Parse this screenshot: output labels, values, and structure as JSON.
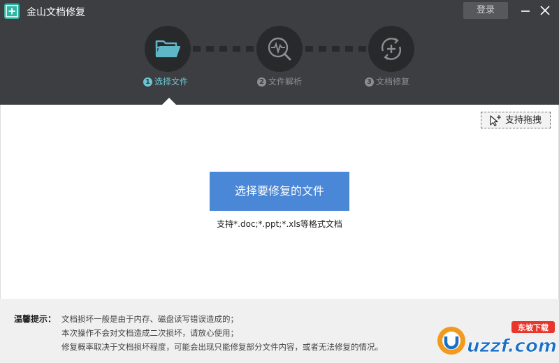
{
  "window": {
    "title": "金山文档修复",
    "login_label": "登录"
  },
  "steps": [
    {
      "number": "1",
      "label": "选择文件",
      "active": true
    },
    {
      "number": "2",
      "label": "文件解析",
      "active": false
    },
    {
      "number": "3",
      "label": "文档修复",
      "active": false
    }
  ],
  "main": {
    "drag_label": "支持拖拽",
    "select_button": "选择要修复的文件",
    "formats_hint": "支持*.doc;*.ppt;*.xls等格式文档"
  },
  "tips": {
    "label": "温馨提示：",
    "lines": [
      "文档损坏一般是由于内存、磁盘读写错误造成的；",
      "本次操作不会对文档造成二次损坏，请放心使用；",
      "修复概率取决于文档损坏程度，可能会出现只能修复部分文件内容，或者无法修复的情况。"
    ]
  },
  "watermark": {
    "brand": "uzzf.com",
    "tag": "东坡下载"
  },
  "colors": {
    "header": "#3d3e42",
    "accent": "#6cc6d2",
    "button": "#4a87d6"
  },
  "icons": [
    "app-logo-icon",
    "minimize-icon",
    "close-icon",
    "folder-icon",
    "analyze-icon",
    "repair-icon",
    "drag-cursor-icon"
  ]
}
